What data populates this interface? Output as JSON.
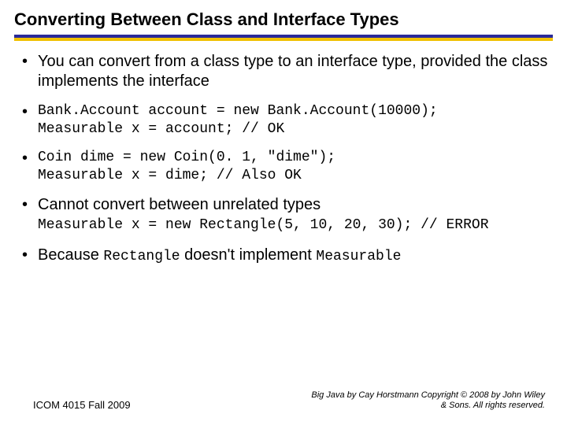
{
  "title": "Converting Between Class and Interface Types",
  "bullets": {
    "b1": "You can convert from a class type to an interface type, provided the class implements the interface",
    "b2_code": "Bank.Account account = new Bank.Account(10000);\nMeasurable x = account; // OK",
    "b3_code": "Coin dime = new Coin(0. 1, \"dime\");\nMeasurable x = dime; // Also OK",
    "b4_text": "Cannot convert between unrelated types",
    "b4_code": "Measurable x = new Rectangle(5, 10, 20, 30); // ERROR",
    "b5_pre": "Because ",
    "b5_code1": "Rectangle",
    "b5_mid": " doesn't implement ",
    "b5_code2": "Measurable"
  },
  "footer": {
    "left": "ICOM 4015 Fall 2009",
    "right": "Big Java by Cay Horstmann Copyright © 2008 by John Wiley & Sons. All rights reserved."
  }
}
